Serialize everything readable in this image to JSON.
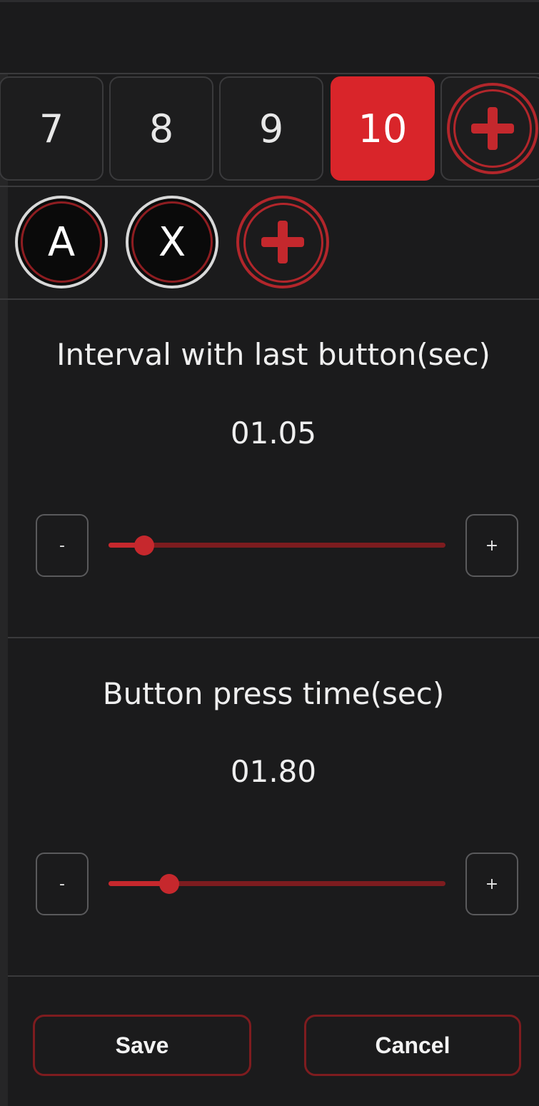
{
  "sequence": {
    "numbers": [
      {
        "label": "7",
        "selected": false
      },
      {
        "label": "8",
        "selected": false
      },
      {
        "label": "9",
        "selected": false
      },
      {
        "label": "10",
        "selected": true
      }
    ],
    "add_icon": "plus-circle-icon"
  },
  "buttons": {
    "keys": [
      {
        "label": "A"
      },
      {
        "label": "X"
      }
    ],
    "add_icon": "plus-circle-icon"
  },
  "interval": {
    "title": "Interval with last button(sec)",
    "value": "01.05",
    "minus_label": "-",
    "plus_label": "+",
    "slider_fraction": 0.105
  },
  "press_time": {
    "title": "Button press time(sec)",
    "value": "01.80",
    "minus_label": "-",
    "plus_label": "+",
    "slider_fraction": 0.18
  },
  "footer": {
    "save_label": "Save",
    "cancel_label": "Cancel"
  },
  "colors": {
    "accent": "#d9252a",
    "background": "#1b1b1c"
  }
}
